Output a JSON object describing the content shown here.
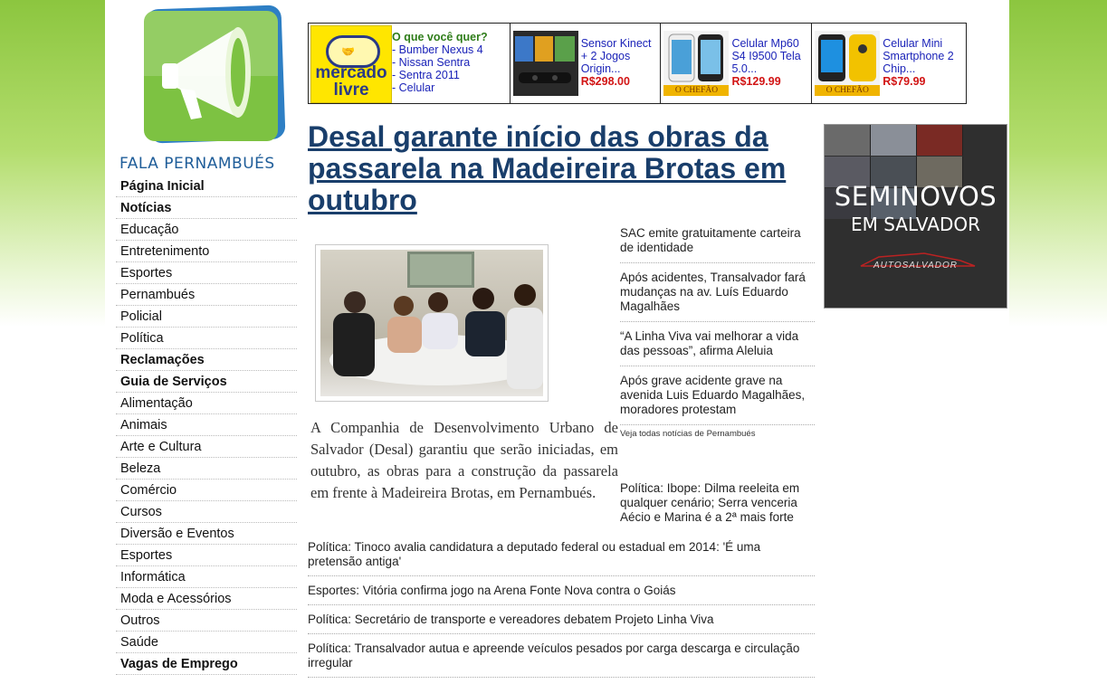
{
  "site": {
    "brand": "FALA PERNAMBUÉS"
  },
  "nav": [
    {
      "label": "Página Inicial",
      "bold": true
    },
    {
      "label": "Notícias",
      "bold": true
    },
    {
      "label": "Educação",
      "bold": false
    },
    {
      "label": "Entretenimento",
      "bold": false
    },
    {
      "label": "Esportes",
      "bold": false
    },
    {
      "label": "Pernambués",
      "bold": false
    },
    {
      "label": "Policial",
      "bold": false
    },
    {
      "label": "Política",
      "bold": false
    },
    {
      "label": "Reclamações",
      "bold": true
    },
    {
      "label": "Guia de Serviços",
      "bold": true
    },
    {
      "label": "Alimentação",
      "bold": false
    },
    {
      "label": "Animais",
      "bold": false
    },
    {
      "label": "Arte e Cultura",
      "bold": false
    },
    {
      "label": "Beleza",
      "bold": false
    },
    {
      "label": "Comércio",
      "bold": false
    },
    {
      "label": "Cursos",
      "bold": false
    },
    {
      "label": "Diversão e Eventos",
      "bold": false
    },
    {
      "label": "Esportes",
      "bold": false
    },
    {
      "label": "Informática",
      "bold": false
    },
    {
      "label": "Moda e Acessórios",
      "bold": false
    },
    {
      "label": "Outros",
      "bold": false
    },
    {
      "label": "Saúde",
      "bold": false
    },
    {
      "label": "Vagas de Emprego",
      "bold": true
    }
  ],
  "ads": {
    "mercadolivre": {
      "logo_text": "mercado livre",
      "question": "O que você quer?",
      "links": [
        "- Bumber Nexus 4",
        "- Nissan Sentra",
        "- Sentra 2011",
        "- Celular"
      ]
    },
    "products": [
      {
        "title": "Sensor Kinect + 2 Jogos Origin...",
        "price": "R$298.00",
        "badge": ""
      },
      {
        "title": "Celular Mp60 S4 I9500 Tela 5.0...",
        "price": "R$129.99",
        "badge": "O CHEFÃO"
      },
      {
        "title": "Celular Mini Smartphone 2 Chip...",
        "price": "R$79.99",
        "badge": "O CHEFÃO"
      }
    ]
  },
  "article": {
    "title": "Desal garante início das obras da passarela na Madeireira Brotas em outubro",
    "lead": "A Companhia de Desenvolvimento Urbano de Salvador (Desal) garantiu que serão iniciadas, em outubro, as obras para a construção da passarela em frente à Madeireira Brotas, em Pernambués."
  },
  "side_news": [
    "SAC emite gratuitamente carteira de identidade",
    "Após acidentes, Transalvador fará mudanças na av. Luís Eduardo Magalhães",
    "“A Linha Viva vai melhorar a vida das pessoas”, afirma Aleluia",
    "Após grave acidente grave na avenida Luis Eduardo Magalhães, moradores protestam"
  ],
  "see_all": "Veja todas notícias de Pernambués",
  "politics_first": "Política: Ibope: Dilma reeleita em qualquer cenário; Serra venceria Aécio e Marina é a 2ª mais forte",
  "bottom_news": [
    "Política: Tinoco avalia candidatura a deputado federal ou estadual em 2014: 'É uma pretensão antiga'",
    "Esportes: Vitória confirma jogo na Arena Fonte Nova contra o Goiás",
    "Política: Secretário de transporte e vereadores debatem Projeto Linha Viva",
    "Política: Transalvador autua e apreende veículos pesados por carga descarga e circulação irregular"
  ],
  "banner": {
    "line1": "SEMINOVOS",
    "line2": "EM SALVADOR",
    "brand": "AUTOSALVADOR"
  },
  "colors": {
    "green": "#8cc63f",
    "title_blue": "#193e6b",
    "link_blue": "#1b23b8",
    "price_red": "#d21515"
  }
}
